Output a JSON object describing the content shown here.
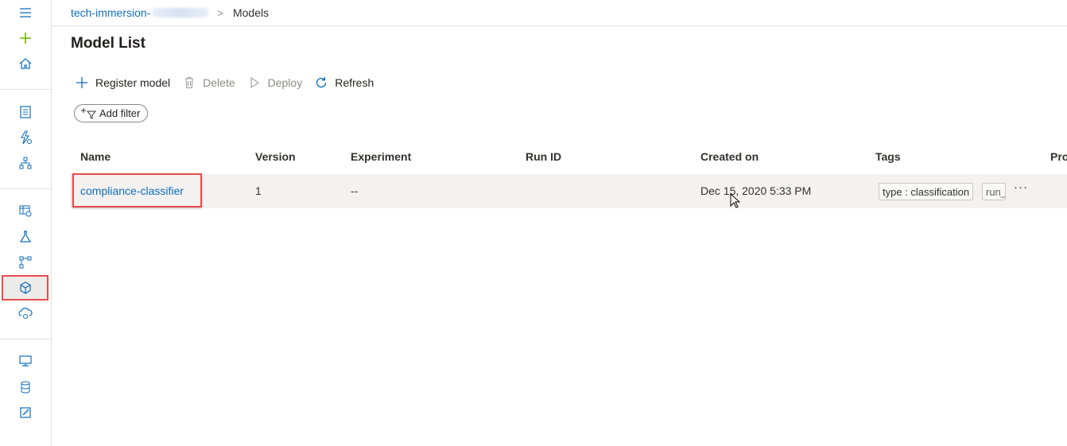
{
  "breadcrumb": {
    "workspace": "tech-immersion-",
    "separator": ">",
    "current": "Models"
  },
  "page": {
    "title": "Model List"
  },
  "toolbar": {
    "register_label": "Register model",
    "delete_label": "Delete",
    "deploy_label": "Deploy",
    "refresh_label": "Refresh"
  },
  "filter": {
    "label": "Add filter"
  },
  "table": {
    "columns": {
      "name": "Name",
      "version": "Version",
      "experiment": "Experiment",
      "run_id": "Run ID",
      "created_on": "Created on",
      "tags": "Tags",
      "properties": "Pro"
    },
    "rows": [
      {
        "name": "compliance-classifier",
        "version": "1",
        "experiment": "--",
        "run_id": "",
        "created_on": "Dec 15, 2020 5:33 PM",
        "tags": [
          "type : classification",
          "run_"
        ],
        "more": "···"
      }
    ]
  },
  "sidebar": {
    "items": [
      {
        "icon": "hamburger-menu-icon"
      },
      {
        "icon": "plus-icon"
      },
      {
        "icon": "home-icon"
      },
      {
        "icon": "notebook-icon"
      },
      {
        "icon": "automated-ml-icon"
      },
      {
        "icon": "designer-icon"
      },
      {
        "icon": "datasets-icon"
      },
      {
        "icon": "experiments-icon"
      },
      {
        "icon": "pipelines-icon"
      },
      {
        "icon": "models-icon",
        "selected": true
      },
      {
        "icon": "endpoints-icon"
      },
      {
        "icon": "compute-icon"
      },
      {
        "icon": "datastores-icon"
      },
      {
        "icon": "data-labeling-icon"
      }
    ]
  },
  "colors": {
    "accent": "#0f6cbd",
    "highlight_border": "#e74c4c",
    "row_bg": "#f3f2f1",
    "add_icon": "#6bb700"
  }
}
